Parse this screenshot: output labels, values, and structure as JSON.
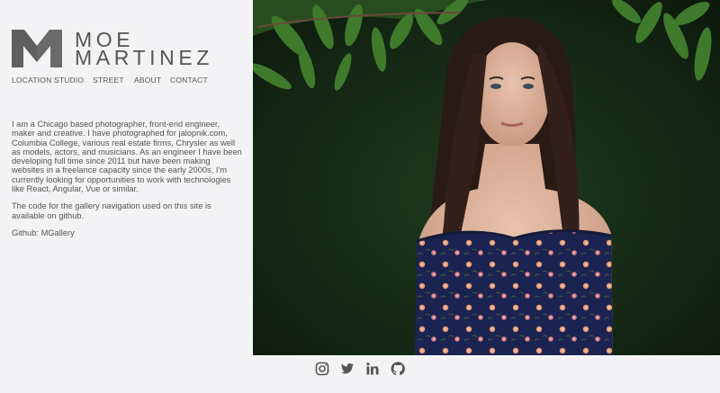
{
  "brand": {
    "line1": "MOE",
    "line2": "MARTINEZ",
    "logo_icon": "m-logo-icon"
  },
  "nav": {
    "items": [
      {
        "label": "LOCATION"
      },
      {
        "label": "STUDIO"
      },
      {
        "label": "STREET"
      },
      {
        "label": "ABOUT"
      },
      {
        "label": "CONTACT"
      }
    ]
  },
  "bio": {
    "paragraph1": "I am a Chicago based photographer, front-end engineer, maker and creative. I have photographed for jalopnik.com, Columbia College, various real estate firms, Chrysler as well as models, actors, and musicians. As an engineer I have been developing full time since 2011 but have been making websites in a freelance capacity since the early 2000s, I'm currently looking for opportunities to work with technologies like React, Angular, Vue or similar.",
    "paragraph2": "The code for the gallery navigation used on this site is available on github.",
    "github_prefix": "Github: ",
    "github_link": "MGallery"
  },
  "photo": {
    "subject": "portrait of a woman with long dark hair in a navy floral off-shoulder top against green foliage"
  },
  "social": {
    "icons": [
      "instagram-icon",
      "twitter-icon",
      "linkedin-icon",
      "github-icon"
    ]
  },
  "colors": {
    "background": "#f3f3f5",
    "text": "#555555",
    "logo": "#6a6a6a"
  }
}
